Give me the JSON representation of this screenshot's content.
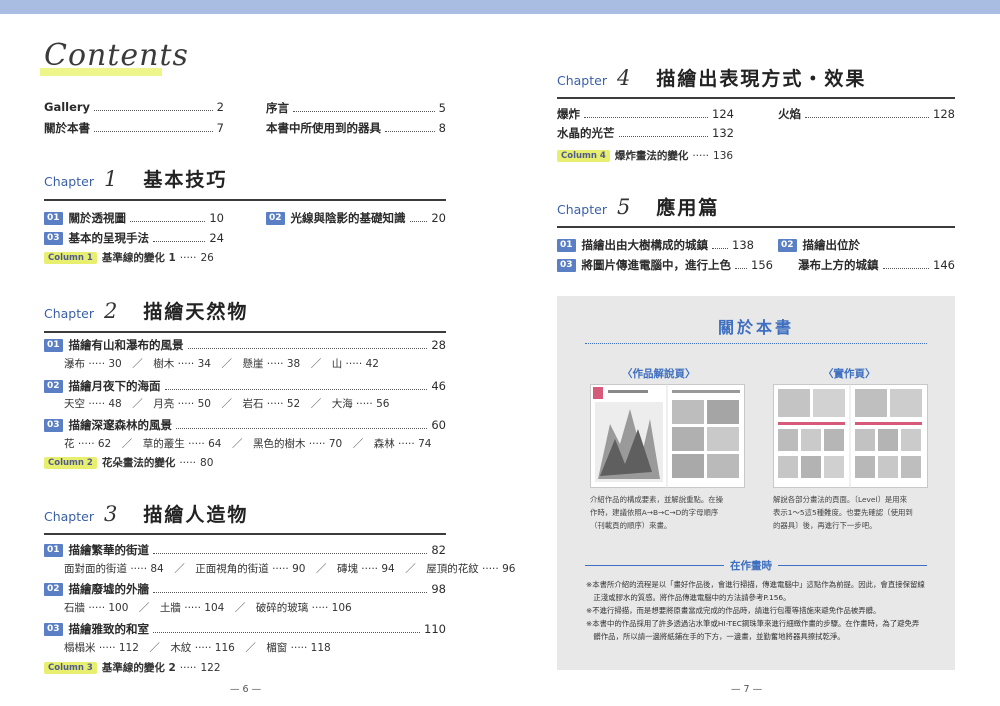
{
  "contents_title": "Contents",
  "left": {
    "intro": [
      {
        "label": "Gallery",
        "page": "2"
      },
      {
        "label": "序言",
        "page": "5"
      },
      {
        "label": "關於本書",
        "page": "7"
      },
      {
        "label": "本書中所使用到的器具",
        "page": "8"
      }
    ],
    "chapters": [
      {
        "word": "Chapter",
        "number": "1",
        "title": "基本技巧",
        "items": [
          {
            "num": "01",
            "label": "關於透視圖",
            "page": "10"
          },
          {
            "num": "02",
            "label": "光線與陰影的基礎知識",
            "page": "20"
          },
          {
            "num": "03",
            "label": "基本的呈現手法",
            "page": "24"
          }
        ],
        "column": {
          "tag": "Column 1",
          "label": "基準線的變化 1",
          "page": "26"
        }
      },
      {
        "word": "Chapter",
        "number": "2",
        "title": "描繪天然物",
        "items": [
          {
            "num": "01",
            "label": "描繪有山和瀑布的風景",
            "page": "28",
            "subs": [
              "瀑布 ····· 30",
              "／",
              "樹木 ····· 34",
              "／",
              "懸崖 ····· 38",
              "／",
              "山 ····· 42"
            ]
          },
          {
            "num": "02",
            "label": "描繪月夜下的海面",
            "page": "46",
            "subs": [
              "天空 ····· 48",
              "／",
              "月亮 ····· 50",
              "／",
              "岩石 ····· 52",
              "／",
              "大海 ····· 56"
            ]
          },
          {
            "num": "03",
            "label": "描繪深邃森林的風景",
            "page": "60",
            "subs": [
              "花 ····· 62",
              "／",
              "草的叢生 ····· 64",
              "／",
              "黑色的樹木 ····· 70",
              "／",
              "森林 ····· 74"
            ]
          }
        ],
        "column": {
          "tag": "Column 2",
          "label": "花朵畫法的變化",
          "page": "80"
        }
      },
      {
        "word": "Chapter",
        "number": "3",
        "title": "描繪人造物",
        "items": [
          {
            "num": "01",
            "label": "描繪繁華的街道",
            "page": "82",
            "subs": [
              "面對面的街道 ····· 84",
              "／",
              "正面視角的街道 ····· 90",
              "／",
              "磚塊 ····· 94",
              "／",
              "屋頂的花紋 ····· 96"
            ]
          },
          {
            "num": "02",
            "label": "描繪廢墟的外牆",
            "page": "98",
            "subs": [
              "石牆 ····· 100",
              "／",
              "土牆 ····· 104",
              "／",
              "破碎的玻璃 ····· 106"
            ]
          },
          {
            "num": "03",
            "label": "描繪雅致的和室",
            "page": "110",
            "subs": [
              "榻榻米 ····· 112",
              "／",
              "木紋 ····· 116",
              "／",
              "楣窗 ····· 118"
            ]
          }
        ],
        "column": {
          "tag": "Column 3",
          "label": "基準線的變化 2",
          "page": "122"
        }
      }
    ],
    "folio": "— 6 —"
  },
  "right": {
    "chapters": [
      {
        "word": "Chapter",
        "number": "4",
        "title": "描繪出表現方式・效果",
        "items": [
          {
            "label": "爆炸",
            "page": "124"
          },
          {
            "label": "火焰",
            "page": "128"
          },
          {
            "label": "水晶的光芒",
            "page": "132"
          }
        ],
        "column": {
          "tag": "Column 4",
          "label": "爆炸畫法的變化",
          "page": "136"
        }
      },
      {
        "word": "Chapter",
        "number": "5",
        "title": "應用篇",
        "items": [
          {
            "num": "01",
            "label": "描繪出由大樹構成的城鎮",
            "page": "138"
          },
          {
            "num": "02",
            "label": "描繪出位於",
            "label2": "瀑布上方的城鎮",
            "page": "146"
          },
          {
            "num": "03",
            "label": "將圖片傳進電腦中，進行上色",
            "page": "156"
          }
        ]
      }
    ],
    "about": {
      "title": "關於本書",
      "left_label": "〈作品解說頁〉",
      "right_label": "〈實作頁〉",
      "left_desc": [
        "介紹作品的構成要素，並解說重點。在操",
        "作時，建議依照A→B→C→D的字母順序",
        "（刊載頁的順序）來畫。"
      ],
      "right_desc": [
        "解說各部分畫法的頁面。〔Level〕是用來",
        "表示1〜5這5種難度。也要先確認〔使用到",
        "的器具〕後，再進行下一步吧。"
      ],
      "mid_label": "在作畫時",
      "notes": [
        "※本書所介紹的流程是以「畫好作品後，會進行掃描，傳進電腦中」這點作為前提。因此，會直接保留線",
        "　正淺或膠水的質感。將作品傳進電腦中的方法請參考P.156。",
        "※不進行掃描，而是想要將原畫當成完成的作品時，請進行包覆等措施來避免作品被弄髒。",
        "※本書中的作品採用了許多透過沾水筆或HI-TEC鋼珠筆來進行細緻作畫的步驟。在作畫時，為了避免弄",
        "　髒作品，所以請一邊將紙鋪在手的下方，一邊畫，並勤奮地將器具擦拭乾淨。"
      ]
    },
    "folio": "— 7 —"
  }
}
